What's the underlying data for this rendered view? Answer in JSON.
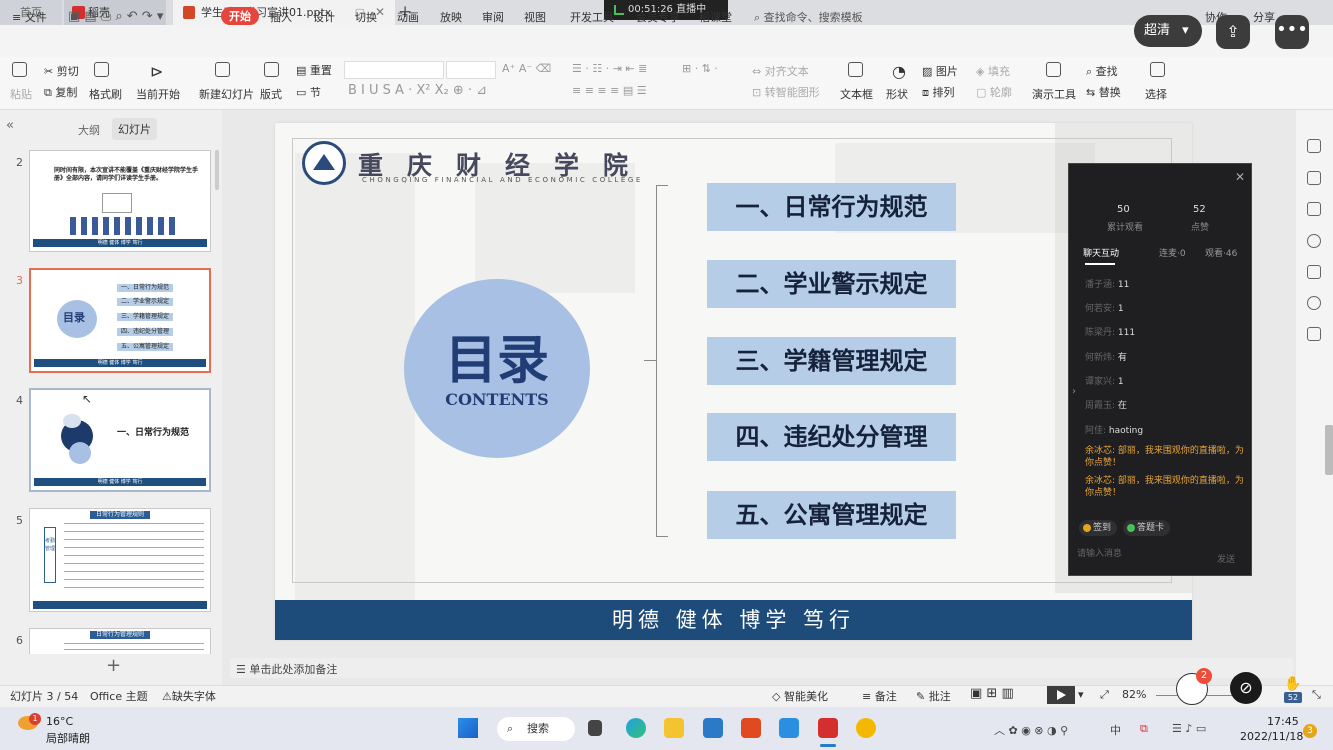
{
  "tabs": {
    "home": "首页",
    "wps": "稻壳",
    "doc": "学生手册学习宣讲01.pptx",
    "min_glyph": "▢",
    "close_glyph": "✕",
    "add_glyph": "+"
  },
  "live_badge": {
    "time": "00:51:26",
    "status": "直播中"
  },
  "menu": {
    "file": "≡ 文件",
    "items": [
      "开始",
      "插入",
      "设计",
      "切换",
      "动画",
      "放映",
      "审阅",
      "视图",
      "开发工具",
      "会员专享",
      "稻课堂"
    ],
    "search": "查找命令、搜索模板",
    "collab": "协作",
    "share": "分享"
  },
  "live_controls": {
    "quality": "超清",
    "quality_arrow": "▾",
    "share_glyph": "⇪",
    "more_glyph": "•••"
  },
  "toolbar": {
    "paste": "粘贴",
    "cut": "剪切",
    "copy": "复制",
    "format_painter": "格式刷",
    "from_current": "当前开始",
    "new_slide": "新建幻灯片",
    "layout": "版式",
    "section": "节",
    "reset": "重置",
    "align_text": "对齐文本",
    "convert_smartart": "转智能图形",
    "textbox": "文本框",
    "shape": "形状",
    "picture": "图片",
    "arrange": "排列",
    "fill": "填充",
    "outline": "轮廓",
    "present_tools": "演示工具",
    "find": "查找",
    "replace": "替换",
    "select": "选择"
  },
  "leftpane": {
    "collapse_glyph": "«",
    "outline_tab": "大纲",
    "slides_tab": "幻灯片",
    "slide_numbers": [
      "2",
      "3",
      "4",
      "5",
      "6"
    ],
    "thumb2_text": "同时间有限，本次宣讲不能覆盖《重庆财经学院学生手册》全部内容，请同学们详读学生手册。",
    "thumb3_title": "目录",
    "thumb3_items": [
      "一、日常行为规范",
      "二、学业警示规定",
      "三、学籍管理规定",
      "四、违纪处分管理",
      "五、公寓管理规定"
    ],
    "thumb4_title": "一、日常行为规范",
    "thumb5_title": "日常行为管理规则",
    "thumb5_side": "考勤管理",
    "thumb6_title": "日常行为管理规则",
    "footer_motto": "明德 健体 博学 笃行",
    "add_glyph": "+"
  },
  "slide": {
    "college_name": "重庆财经学院",
    "college_en": "CHONGQING FINANCIAL AND ECONOMIC COLLEGE",
    "toc_title": "目录",
    "toc_sub": "CONTENTS",
    "items": [
      "一、日常行为规范",
      "二、学业警示规定",
      "三、学籍管理规定",
      "四、违纪处分管理",
      "五、公寓管理规定"
    ],
    "motto": "明德  健体  博学  笃行"
  },
  "chat": {
    "close_glyph": "✕",
    "stat1_num": "50",
    "stat1_label": "累计观看",
    "stat2_num": "52",
    "stat2_label": "点赞",
    "tab_chat": "聊天互动",
    "tab_mic": "连麦·0",
    "tab_viewers": "观看·46",
    "messages": [
      {
        "who": "潘子涵:",
        "text": "11"
      },
      {
        "who": "何若安:",
        "text": "1"
      },
      {
        "who": "陈梁丹:",
        "text": "111"
      },
      {
        "who": "何新炜:",
        "text": "有"
      },
      {
        "who": "谭家兴:",
        "text": "1"
      },
      {
        "who": "周霞玉:",
        "text": "在"
      },
      {
        "who": "阿佳:",
        "text": "haoting"
      }
    ],
    "orange1": "余冰芯: 部丽，我来围观你的直播啦，为你点赞！",
    "orange2": "余冰芯: 部丽，我来围观你的直播啦，为你点赞！",
    "pill_signin": "签到",
    "pill_lottery": "答题卡",
    "input_placeholder": "请输入消息",
    "send": "发送"
  },
  "notes": {
    "placeholder": "单击此处添加备注"
  },
  "status": {
    "slide_info": "幻灯片 3 / 54",
    "theme": "Office 主题",
    "missing_font": "缺失字体",
    "smart_beautify": "智能美化",
    "notes": "备注",
    "comments": "批注",
    "zoom": "82%",
    "badge": "2",
    "likes": "52",
    "link_glyph": "⊘"
  },
  "taskbar": {
    "weather_badge": "1",
    "temp": "16°C",
    "weather": "局部晴朗",
    "search": "搜索",
    "time": "17:45",
    "date": "2022/11/18",
    "notif": "3",
    "ime": "中"
  },
  "colors": {
    "accent_red": "#e7453b",
    "slide_navy": "#1d4b7a",
    "toc_box": "#b5cde6",
    "circle": "#a7c0e3",
    "chat_orange": "#e7a43a"
  }
}
